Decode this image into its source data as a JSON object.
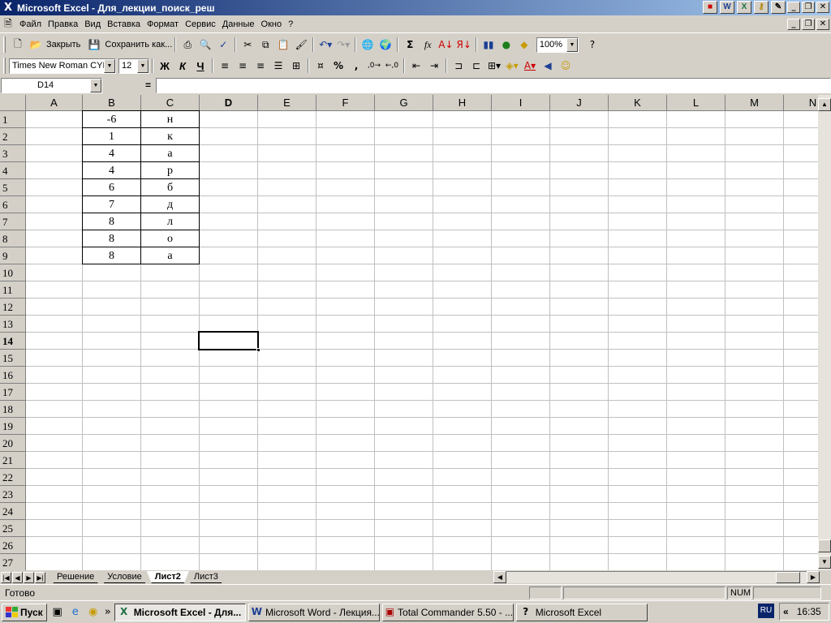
{
  "window": {
    "title": "Microsoft Excel - Для_лекции_поиск_реш"
  },
  "menu": [
    "Файл",
    "Правка",
    "Вид",
    "Вставка",
    "Формат",
    "Сервис",
    "Данные",
    "Окно",
    "?"
  ],
  "toolbar": {
    "close_label": "Закрыть",
    "save_as_label": "Сохранить как...",
    "zoom": "100%",
    "sum": "Σ",
    "fx": "fx",
    "percent": "%",
    "comma": ","
  },
  "format": {
    "font": "Times New Roman CYR",
    "size": "12",
    "bold": "Ж",
    "italic": "К",
    "underline": "Ч"
  },
  "formula": {
    "name_box": "D14",
    "equals": "="
  },
  "columns": [
    "A",
    "B",
    "C",
    "D",
    "E",
    "F",
    "G",
    "H",
    "I",
    "J",
    "K",
    "L",
    "M",
    "N"
  ],
  "active_column": "D",
  "rows": [
    "1",
    "2",
    "3",
    "4",
    "5",
    "6",
    "7",
    "8",
    "9",
    "10",
    "11",
    "12",
    "13",
    "14",
    "15",
    "16",
    "17",
    "18",
    "19",
    "20",
    "21",
    "22",
    "23",
    "24",
    "25",
    "26",
    "27"
  ],
  "active_row": "14",
  "cells": [
    {
      "b": "-6",
      "c": "н"
    },
    {
      "b": "1",
      "c": "к"
    },
    {
      "b": "4",
      "c": "а"
    },
    {
      "b": "4",
      "c": "р"
    },
    {
      "b": "6",
      "c": "б"
    },
    {
      "b": "7",
      "c": "д"
    },
    {
      "b": "8",
      "c": "л"
    },
    {
      "b": "8",
      "c": "о"
    },
    {
      "b": "8",
      "c": "а"
    }
  ],
  "sheets": [
    {
      "name": "Решение",
      "active": false
    },
    {
      "name": "Условие",
      "active": false
    },
    {
      "name": "Лист2",
      "active": true
    },
    {
      "name": "Лист3",
      "active": false
    }
  ],
  "status": {
    "text": "Готово",
    "num": "NUM"
  },
  "taskbar": {
    "start": "Пуск",
    "tasks": [
      {
        "label": "Microsoft Excel - Для...",
        "icon": "X",
        "active": true
      },
      {
        "label": "Microsoft Word - Лекция...",
        "icon": "W",
        "active": false
      },
      {
        "label": "Total Commander 5.50 - ...",
        "icon": "▣",
        "active": false
      },
      {
        "label": "Microsoft Excel",
        "icon": "?",
        "active": false
      }
    ],
    "lang": "RU",
    "clock": "16:35"
  }
}
